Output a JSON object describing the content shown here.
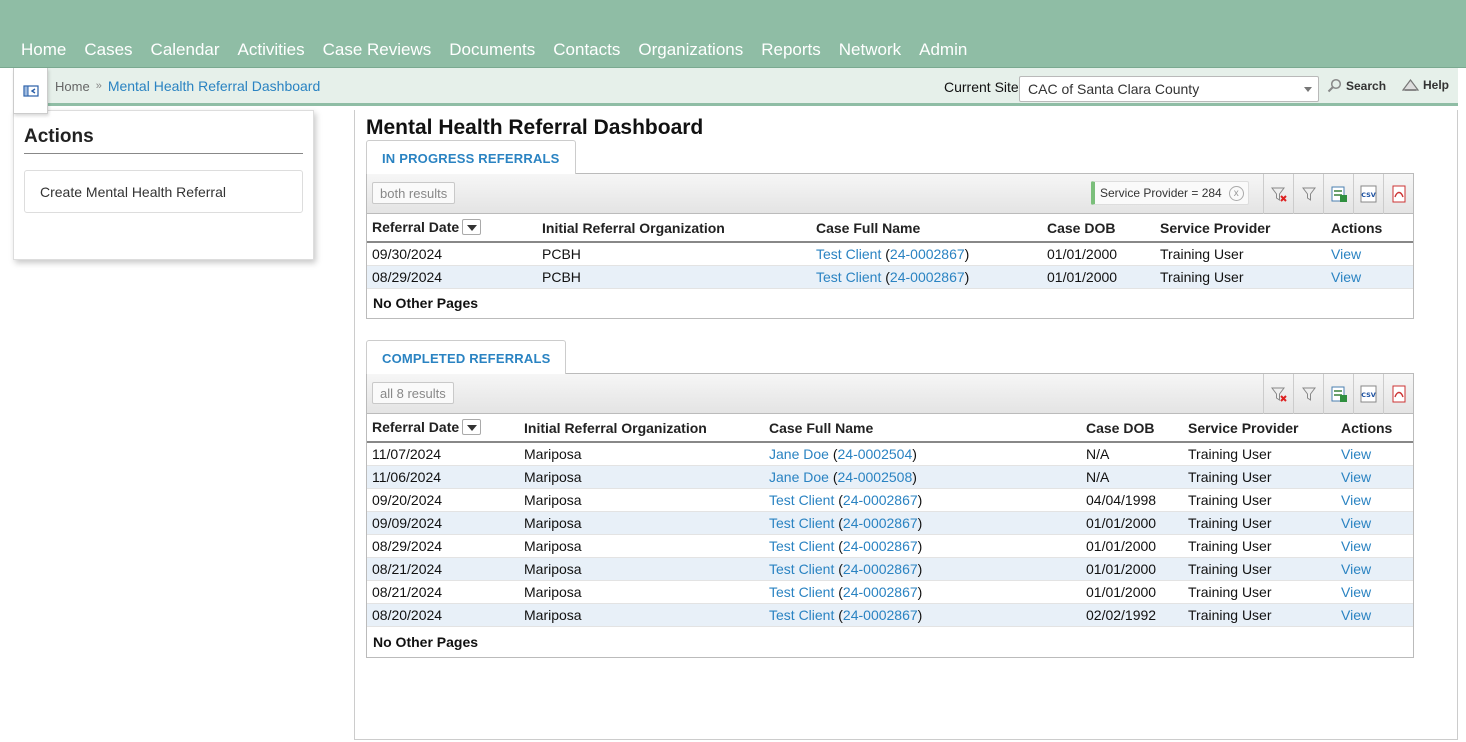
{
  "nav": {
    "items": [
      "Home",
      "Cases",
      "Calendar",
      "Activities",
      "Case Reviews",
      "Documents",
      "Contacts",
      "Organizations",
      "Reports",
      "Network",
      "Admin"
    ]
  },
  "breadcrumb": {
    "home": "Home",
    "separator": "»",
    "current": "Mental Health Referral Dashboard"
  },
  "site": {
    "label": "Current Site",
    "selected": "CAC of Santa Clara County"
  },
  "header_links": {
    "search": "Search",
    "help": "Help"
  },
  "sidebar": {
    "title": "Actions",
    "items": [
      "Create Mental Health Referral"
    ]
  },
  "page": {
    "title": "Mental Health Referral Dashboard"
  },
  "in_progress": {
    "tab_label": "IN PROGRESS REFERRALS",
    "results": "both results",
    "filter": "Service Provider = 284",
    "filter_remove": "x",
    "columns": [
      "Referral Date",
      "Initial Referral Organization",
      "Case Full Name",
      "Case DOB",
      "Service Provider",
      "Actions"
    ],
    "rows": [
      {
        "date": "09/30/2024",
        "org": "PCBH",
        "name": "Test Client",
        "case_no": "24-0002867",
        "dob": "01/01/2000",
        "provider": "Training User",
        "action": "View"
      },
      {
        "date": "08/29/2024",
        "org": "PCBH",
        "name": "Test Client",
        "case_no": "24-0002867",
        "dob": "01/01/2000",
        "provider": "Training User",
        "action": "View"
      }
    ],
    "footer": "No Other Pages"
  },
  "completed": {
    "tab_label": "COMPLETED REFERRALS",
    "results": "all 8 results",
    "columns": [
      "Referral Date",
      "Initial Referral Organization",
      "Case Full Name",
      "Case DOB",
      "Service Provider",
      "Actions"
    ],
    "rows": [
      {
        "date": "11/07/2024",
        "org": "Mariposa",
        "name": "Jane Doe",
        "case_no": "24-0002504",
        "dob": "N/A",
        "provider": "Training User",
        "action": "View"
      },
      {
        "date": "11/06/2024",
        "org": "Mariposa",
        "name": "Jane Doe",
        "case_no": "24-0002508",
        "dob": "N/A",
        "provider": "Training User",
        "action": "View"
      },
      {
        "date": "09/20/2024",
        "org": "Mariposa",
        "name": "Test Client",
        "case_no": "24-0002867",
        "dob": "04/04/1998",
        "provider": "Training User",
        "action": "View"
      },
      {
        "date": "09/09/2024",
        "org": "Mariposa",
        "name": "Test Client",
        "case_no": "24-0002867",
        "dob": "01/01/2000",
        "provider": "Training User",
        "action": "View"
      },
      {
        "date": "08/29/2024",
        "org": "Mariposa",
        "name": "Test Client",
        "case_no": "24-0002867",
        "dob": "01/01/2000",
        "provider": "Training User",
        "action": "View"
      },
      {
        "date": "08/21/2024",
        "org": "Mariposa",
        "name": "Test Client",
        "case_no": "24-0002867",
        "dob": "01/01/2000",
        "provider": "Training User",
        "action": "View"
      },
      {
        "date": "08/21/2024",
        "org": "Mariposa",
        "name": "Test Client",
        "case_no": "24-0002867",
        "dob": "01/01/2000",
        "provider": "Training User",
        "action": "View"
      },
      {
        "date": "08/20/2024",
        "org": "Mariposa",
        "name": "Test Client",
        "case_no": "24-0002867",
        "dob": "02/02/1992",
        "provider": "Training User",
        "action": "View"
      }
    ],
    "footer": "No Other Pages"
  },
  "toolbar_icons": [
    "clear-filter-icon",
    "filter-icon",
    "excel-export-icon",
    "csv-export-icon",
    "pdf-export-icon"
  ],
  "colors": {
    "topbar": "#8fbda5",
    "subbar": "#e6f0ea",
    "link": "#2a83c2",
    "alt_row": "#e8f0f8"
  }
}
